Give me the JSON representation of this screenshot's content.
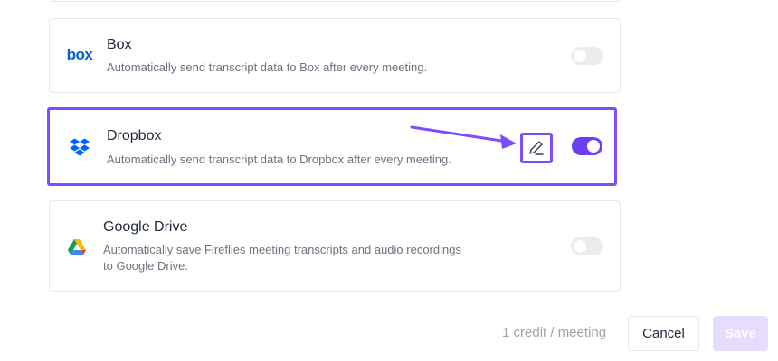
{
  "integrations": [
    {
      "name": "Box",
      "description": "Automatically send transcript data to Box after every meeting.",
      "logo_text": "box",
      "enabled": false
    },
    {
      "name": "Dropbox",
      "description": "Automatically send transcript data to Dropbox after every meeting.",
      "enabled": true
    },
    {
      "name": "Google Drive",
      "description_line1": "Automatically save Fireflies meeting transcripts and audio recordings",
      "description_line2": "to Google Drive.",
      "enabled": false
    }
  ],
  "footer": {
    "credit_text": "1 credit / meeting",
    "cancel_label": "Cancel",
    "save_label": "Save"
  },
  "colors": {
    "accent": "#6d3df0",
    "highlight": "#7c4dff",
    "box_blue": "#0061d5",
    "dropbox_blue": "#0061fe",
    "save_disabled": "#e6dcfd"
  },
  "icons": {
    "box": "box-logo-icon",
    "dropbox": "dropbox-logo-icon",
    "gdrive": "google-drive-logo-icon",
    "edit": "pencil-icon",
    "arrow": "annotation-arrow-icon"
  }
}
